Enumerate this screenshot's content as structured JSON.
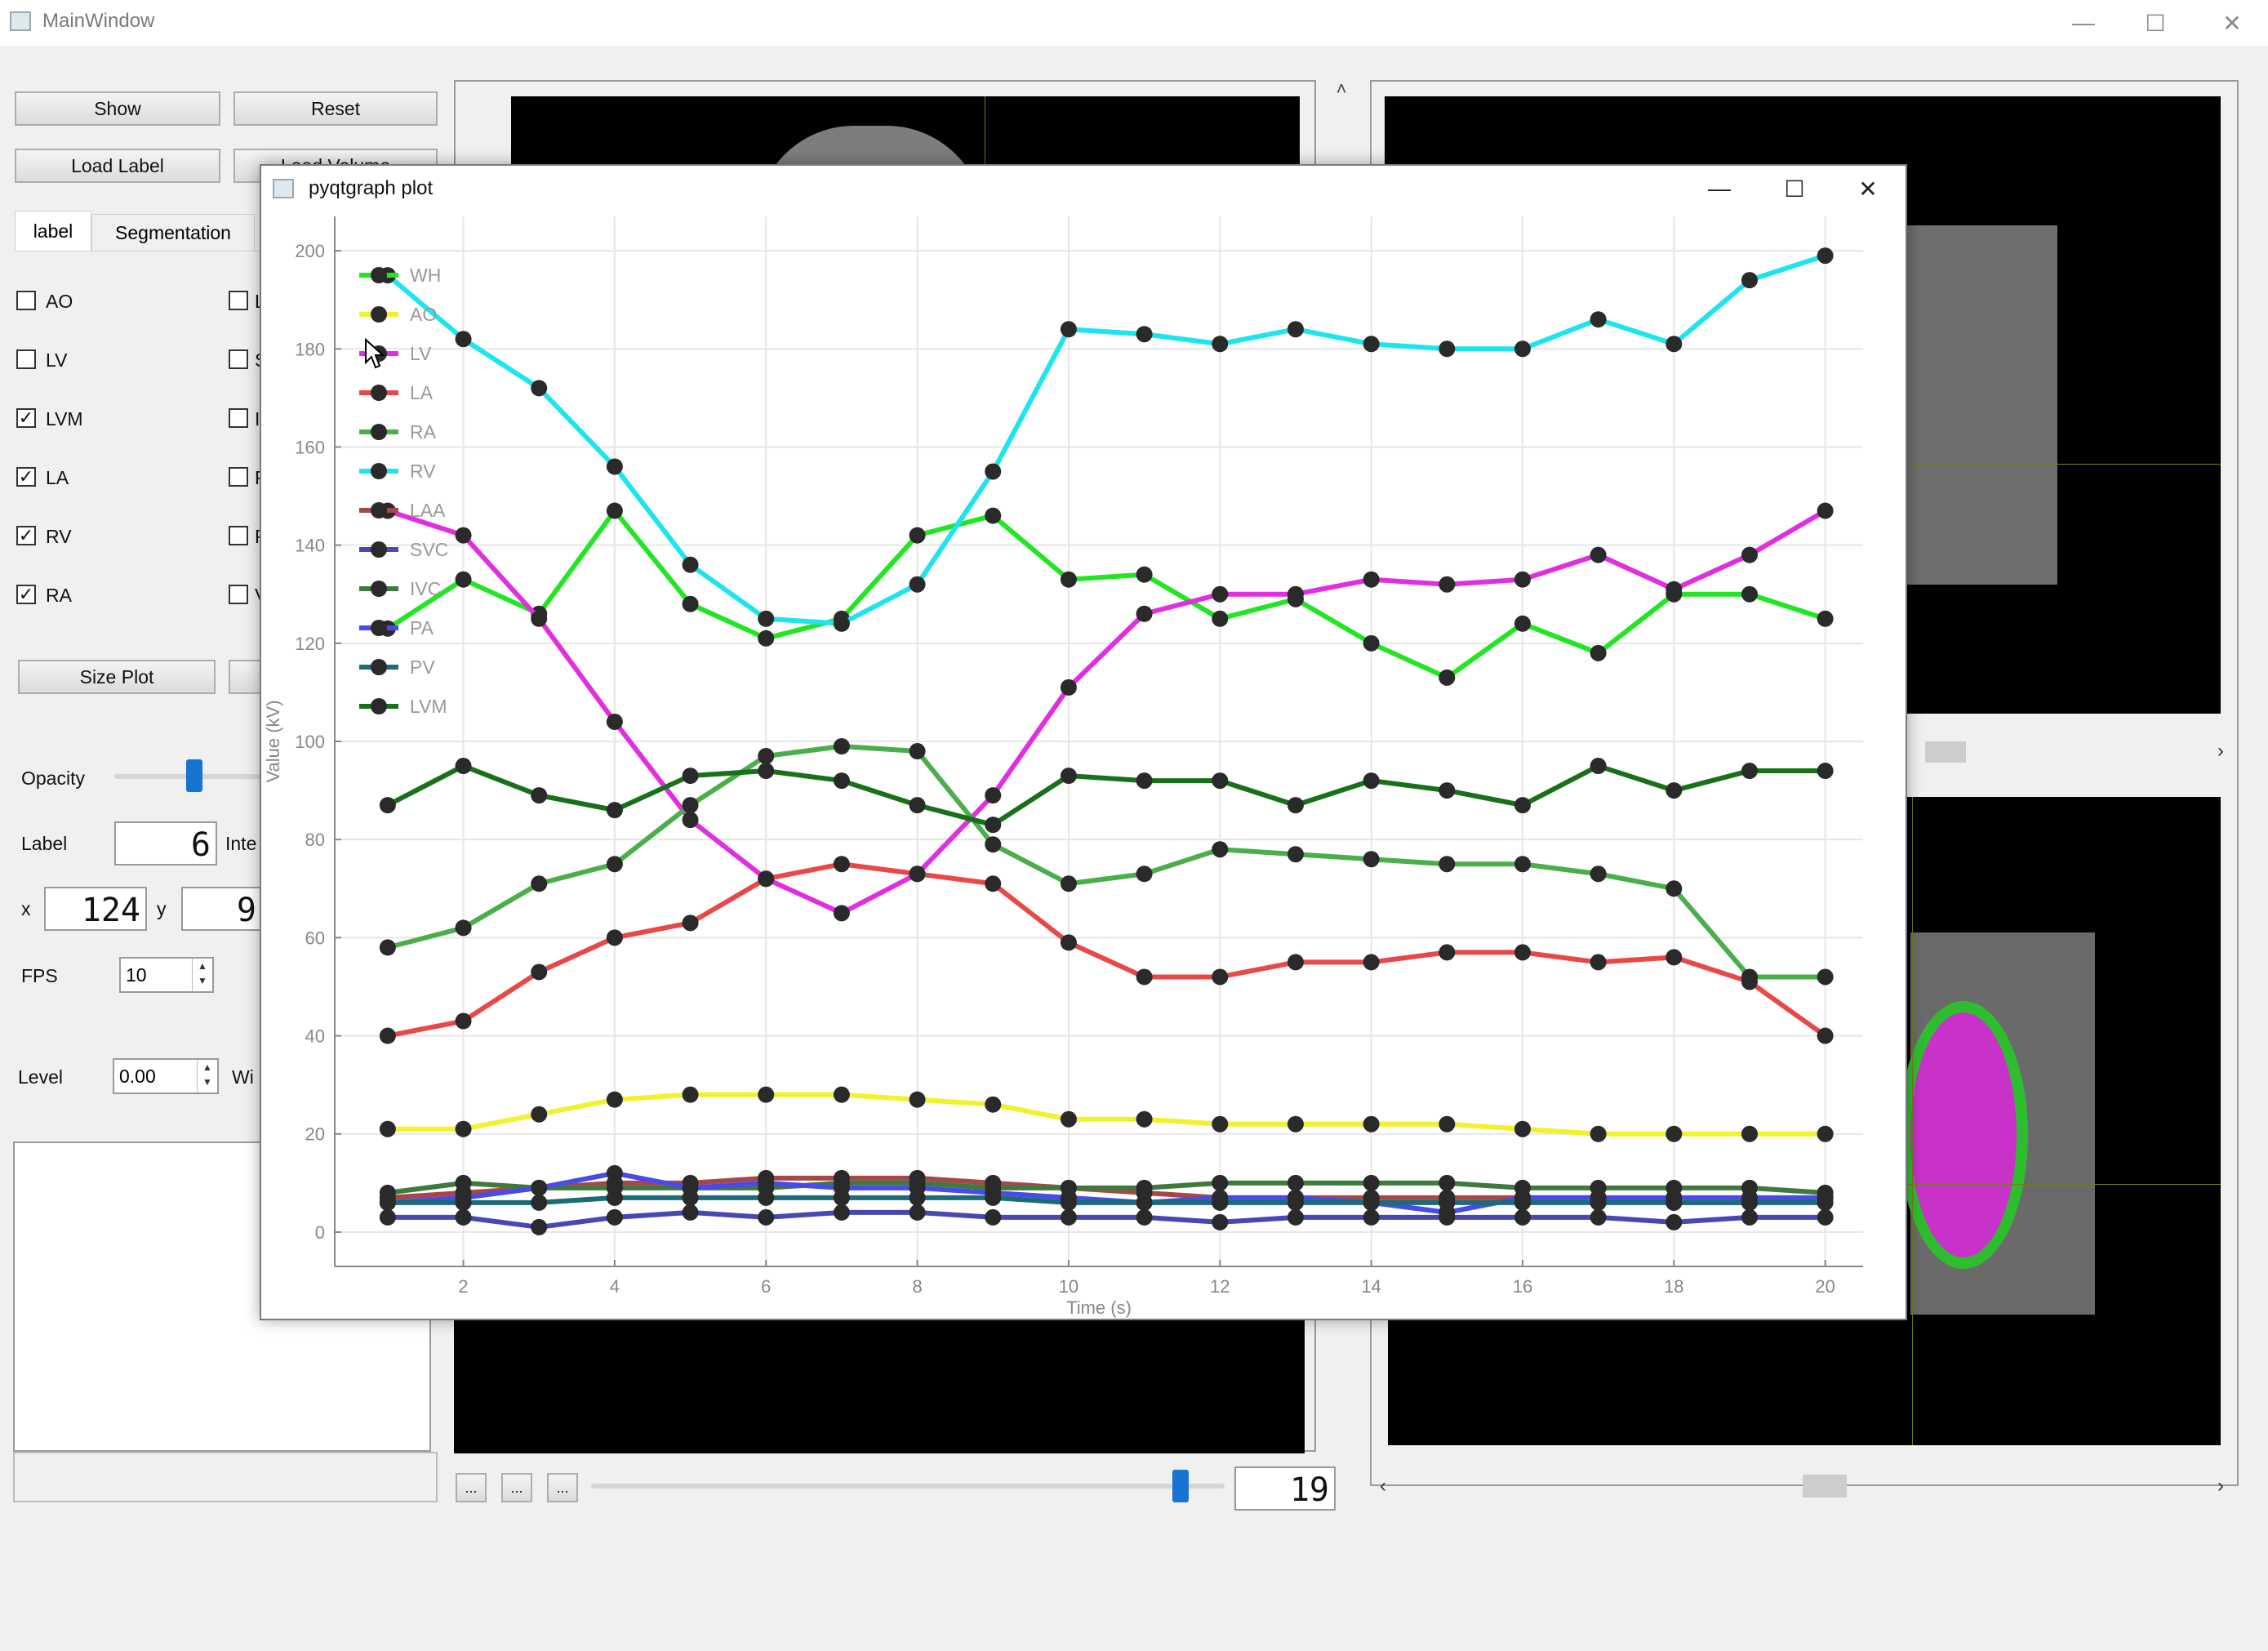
{
  "main_window": {
    "title": "MainWindow",
    "buttons": {
      "show": "Show",
      "reset": "Reset",
      "load_label": "Load Label",
      "load_volume": "Load Volume",
      "size_plot": "Size Plot"
    },
    "tabs": [
      "label",
      "Segmentation"
    ],
    "checkboxes_left": [
      {
        "label": "AO",
        "checked": false
      },
      {
        "label": "LV",
        "checked": false
      },
      {
        "label": "LVM",
        "checked": true
      },
      {
        "label": "LA",
        "checked": true
      },
      {
        "label": "RV",
        "checked": true
      },
      {
        "label": "RA",
        "checked": true
      }
    ],
    "checkboxes_right_initials": [
      "L",
      "S",
      "I",
      "P",
      "P",
      "V"
    ],
    "opacity_label": "Opacity",
    "label_label": "Label",
    "label_value": "6",
    "inte_label": "Inte",
    "x_label": "x",
    "x_value": "124",
    "y_label": "y",
    "y_value": "9",
    "fps_label": "FPS",
    "fps_value": "10",
    "level_label": "Level",
    "level_value": "0.00",
    "window_label": "Wi",
    "frame_value": "19",
    "nav_buttons": [
      "...",
      "...",
      "..."
    ]
  },
  "plot_window": {
    "title": "pyqtgraph plot"
  },
  "chart_data": {
    "type": "line",
    "title": "",
    "xlabel": "Time (s)",
    "ylabel": "Value (kV)",
    "xlim": [
      0.3,
      20.5
    ],
    "ylim": [
      -7,
      207
    ],
    "xticks": [
      2,
      4,
      6,
      8,
      10,
      12,
      14,
      16,
      18,
      20
    ],
    "yticks": [
      0,
      20,
      40,
      60,
      80,
      100,
      120,
      140,
      160,
      180,
      200
    ],
    "grid": true,
    "legend_position": "top-left",
    "x": [
      1,
      2,
      3,
      4,
      5,
      6,
      7,
      8,
      9,
      10,
      11,
      12,
      13,
      14,
      15,
      16,
      17,
      18,
      19,
      20
    ],
    "series": [
      {
        "name": "WH",
        "color": "#22e622",
        "values": [
          123,
          133,
          126,
          147,
          128,
          121,
          125,
          142,
          146,
          133,
          134,
          125,
          129,
          120,
          113,
          124,
          118,
          130,
          130,
          125
        ]
      },
      {
        "name": "AO",
        "color": "#f2f22c",
        "values": [
          21,
          21,
          24,
          27,
          28,
          28,
          28,
          27,
          26,
          23,
          23,
          22,
          22,
          22,
          22,
          21,
          20,
          20,
          20,
          20
        ]
      },
      {
        "name": "LV",
        "color": "#e12ee1",
        "values": [
          147,
          142,
          125,
          104,
          84,
          72,
          65,
          73,
          89,
          111,
          126,
          130,
          130,
          133,
          132,
          133,
          138,
          131,
          138,
          147
        ]
      },
      {
        "name": "LA",
        "color": "#e84848",
        "values": [
          40,
          43,
          53,
          60,
          63,
          72,
          75,
          73,
          71,
          59,
          52,
          52,
          55,
          55,
          57,
          57,
          55,
          56,
          51,
          40
        ]
      },
      {
        "name": "RA",
        "color": "#4aae4a",
        "values": [
          58,
          62,
          71,
          75,
          87,
          97,
          99,
          98,
          79,
          71,
          73,
          78,
          77,
          76,
          75,
          75,
          73,
          70,
          52,
          52
        ]
      },
      {
        "name": "RV",
        "color": "#1ee4f0",
        "values": [
          195,
          182,
          172,
          156,
          136,
          125,
          124,
          132,
          155,
          184,
          183,
          181,
          184,
          181,
          180,
          180,
          186,
          181,
          194,
          199
        ]
      },
      {
        "name": "LAA",
        "color": "#a64848",
        "values": [
          7,
          8,
          9,
          10,
          10,
          11,
          11,
          11,
          10,
          9,
          8,
          7,
          7,
          7,
          7,
          7,
          7,
          6,
          6,
          7
        ]
      },
      {
        "name": "SVC",
        "color": "#4848b4",
        "values": [
          3,
          3,
          1,
          3,
          4,
          3,
          4,
          4,
          3,
          3,
          3,
          2,
          3,
          3,
          3,
          3,
          3,
          2,
          3,
          3
        ]
      },
      {
        "name": "IVC",
        "color": "#3e7a3e",
        "values": [
          8,
          10,
          9,
          9,
          9,
          9,
          10,
          10,
          9,
          9,
          9,
          10,
          10,
          10,
          10,
          9,
          9,
          9,
          9,
          8
        ]
      },
      {
        "name": "PA",
        "color": "#4a4ae8",
        "values": [
          6,
          7,
          9,
          12,
          9,
          10,
          9,
          9,
          8,
          7,
          6,
          7,
          7,
          6,
          4,
          7,
          7,
          7,
          7,
          7
        ]
      },
      {
        "name": "PV",
        "color": "#1a6c78",
        "values": [
          6,
          6,
          6,
          7,
          7,
          7,
          7,
          7,
          7,
          6,
          6,
          6,
          6,
          6,
          6,
          6,
          6,
          6,
          6,
          6
        ]
      },
      {
        "name": "LVM",
        "color": "#187018",
        "values": [
          87,
          95,
          89,
          86,
          93,
          94,
          92,
          87,
          83,
          93,
          92,
          92,
          87,
          92,
          90,
          87,
          95,
          90,
          94,
          94
        ]
      }
    ]
  }
}
